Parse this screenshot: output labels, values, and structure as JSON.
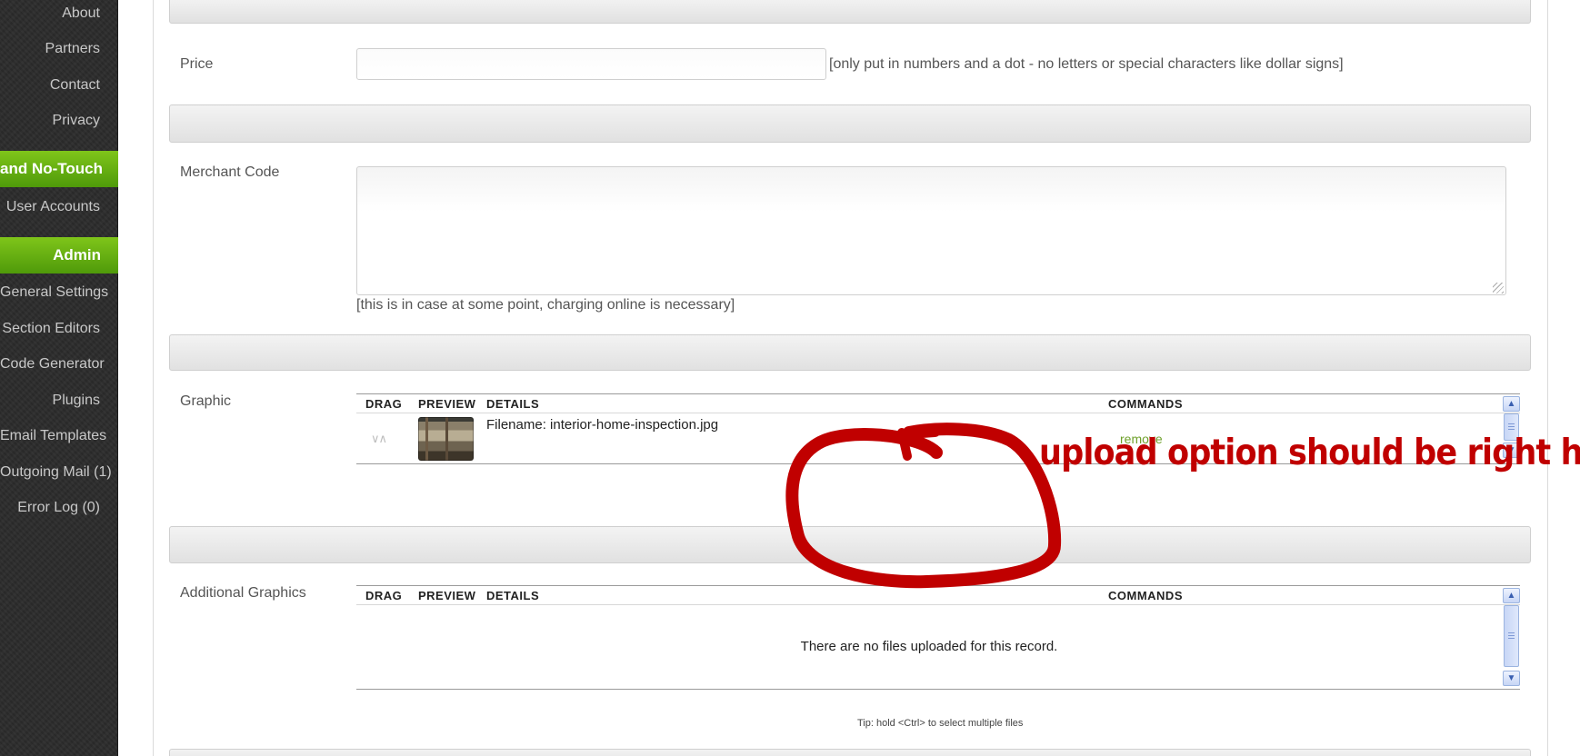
{
  "sidebar": {
    "links_top": [
      "About",
      "Partners",
      "Contact",
      "Privacy"
    ],
    "section_1": "and No-Touch",
    "section_1_items": [
      "User Accounts"
    ],
    "section_2": "Admin",
    "section_2_items": [
      "General Settings",
      "Section Editors",
      "Code Generator",
      "Plugins",
      "Email Templates",
      "Outgoing Mail (1)",
      "Error Log (0)"
    ]
  },
  "form": {
    "price": {
      "label": "Price",
      "value": "",
      "note": "[only put in numbers and a dot - no letters or special characters like dollar signs]"
    },
    "merchant_code": {
      "label": "Merchant Code",
      "value": "",
      "note": "[this is in case at some point, charging online is necessary]"
    },
    "graphic": {
      "label": "Graphic",
      "columns": [
        "DRAG",
        "PREVIEW",
        "DETAILS",
        "COMMANDS"
      ],
      "files": [
        {
          "filename": "Filename: interior-home-inspection.jpg",
          "command": "remove"
        }
      ]
    },
    "additional_graphics": {
      "label": "Additional Graphics",
      "columns": [
        "DRAG",
        "PREVIEW",
        "DETAILS",
        "COMMANDS"
      ],
      "empty_message": "There are no files uploaded for this record.",
      "tip": "Tip: hold <Ctrl> to select multiple files"
    }
  },
  "annotation": {
    "text": "upload option should be right here",
    "color": "#c00000"
  },
  "colors": {
    "sidebar_bg": "#2b2b2b",
    "sidebar_heading": "#5aa60f",
    "link_green": "#6ea02a"
  }
}
